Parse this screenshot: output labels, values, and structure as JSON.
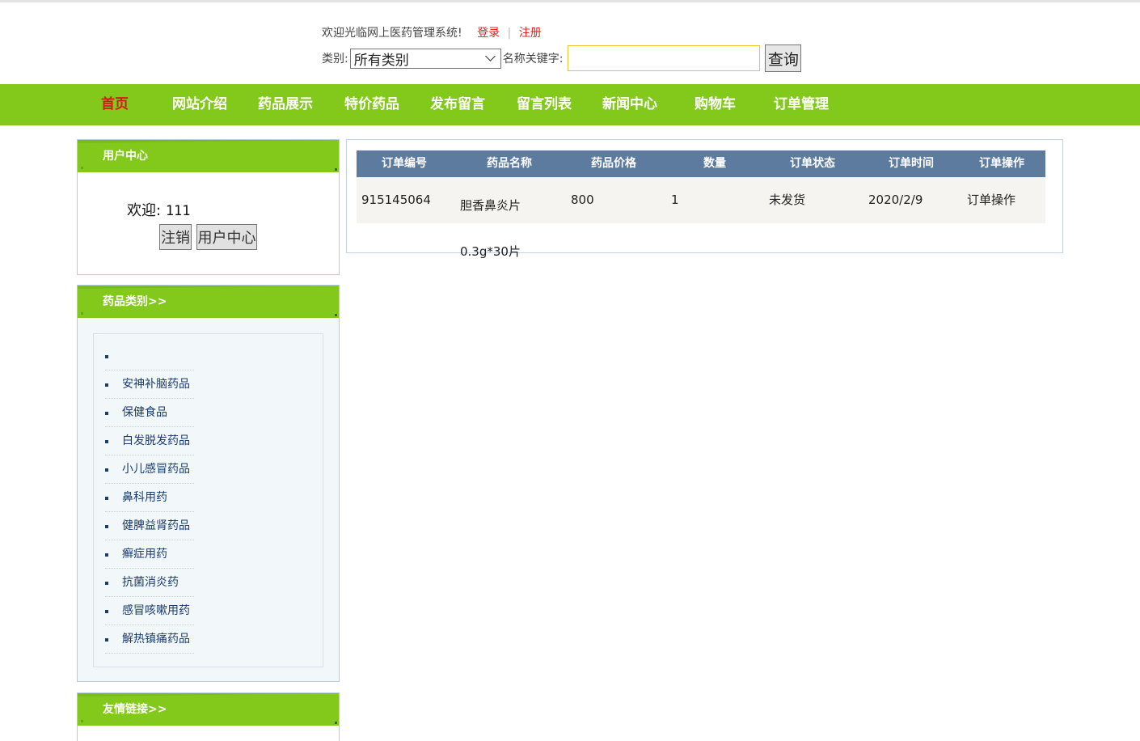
{
  "header": {
    "welcome": "欢迎光临网上医药管理系统!",
    "login": "登录",
    "separator": "|",
    "register": "注册",
    "category_label": "类别:",
    "category_selected": "所有类别",
    "keyword_label": "名称关键字:",
    "keyword_value": "",
    "search_button": "查询"
  },
  "nav": {
    "items": [
      "首页",
      "网站介绍",
      "药品展示",
      "特价药品",
      "发布留言",
      "留言列表",
      "新闻中心",
      "购物车",
      "订单管理"
    ]
  },
  "user_center": {
    "title": "用户中心",
    "welcome_prefix": "欢迎:",
    "username": "111",
    "logout_button": "注销",
    "center_button": "用户中心"
  },
  "categories": {
    "title": "药品类别>>",
    "items": [
      "",
      "安神补脑药品",
      "保健食品",
      "白发脱发药品",
      "小儿感冒药品",
      "鼻科用药",
      "健脾益肾药品",
      "癣症用药",
      "抗菌消炎药",
      "感冒咳嗽用药",
      "解热镇痛药品"
    ]
  },
  "links": {
    "title": "友情链接>>"
  },
  "orders": {
    "headers": [
      "订单编号",
      "药品名称",
      "药品价格",
      "数量",
      "订单状态",
      "订单时间",
      "订单操作"
    ],
    "rows": [
      {
        "id": "915145064",
        "name_line1": "胆香鼻炎片",
        "name_line2": "0.3g*30片",
        "price": "800",
        "quantity": "1",
        "status": "未发货",
        "date": "2020/2/9",
        "action": "订单操作"
      }
    ]
  },
  "colors": {
    "nav_green": "#82c91b",
    "active_red": "#d61a1a",
    "table_header": "#5d7b9e",
    "category_text": "#1a3c6e"
  }
}
